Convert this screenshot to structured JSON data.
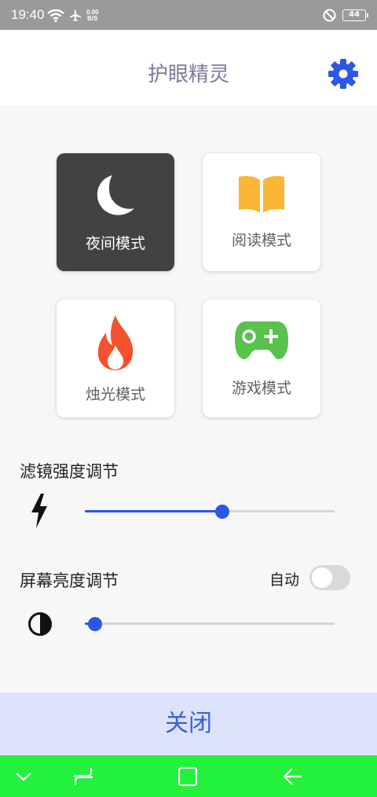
{
  "status_bar": {
    "time": "19:40",
    "net_speed_value": "0.00",
    "net_speed_unit": "B/S",
    "battery_level": "44"
  },
  "header": {
    "title": "护眼精灵",
    "settings_icon": "gear-icon",
    "accent_color": "#2c57e8"
  },
  "modes": [
    {
      "label": "夜间模式",
      "icon": "moon-icon",
      "active": true
    },
    {
      "label": "阅读模式",
      "icon": "book-icon",
      "active": false
    },
    {
      "label": "烛光模式",
      "icon": "flame-icon",
      "active": false
    },
    {
      "label": "游戏模式",
      "icon": "gamepad-icon",
      "active": false
    }
  ],
  "filter": {
    "title": "滤镜强度调节",
    "icon": "lightning-icon",
    "value_fraction": 0.55
  },
  "brightness": {
    "title": "屏幕亮度调节",
    "auto_label": "自动",
    "auto_enabled": false,
    "icon": "contrast-icon",
    "value_fraction": 0.04
  },
  "close_button": {
    "label": "关闭"
  },
  "nav_bar": {
    "color": "#22f23b",
    "buttons": [
      "chevron-down-icon",
      "recents-icon",
      "home-icon",
      "back-icon"
    ]
  }
}
